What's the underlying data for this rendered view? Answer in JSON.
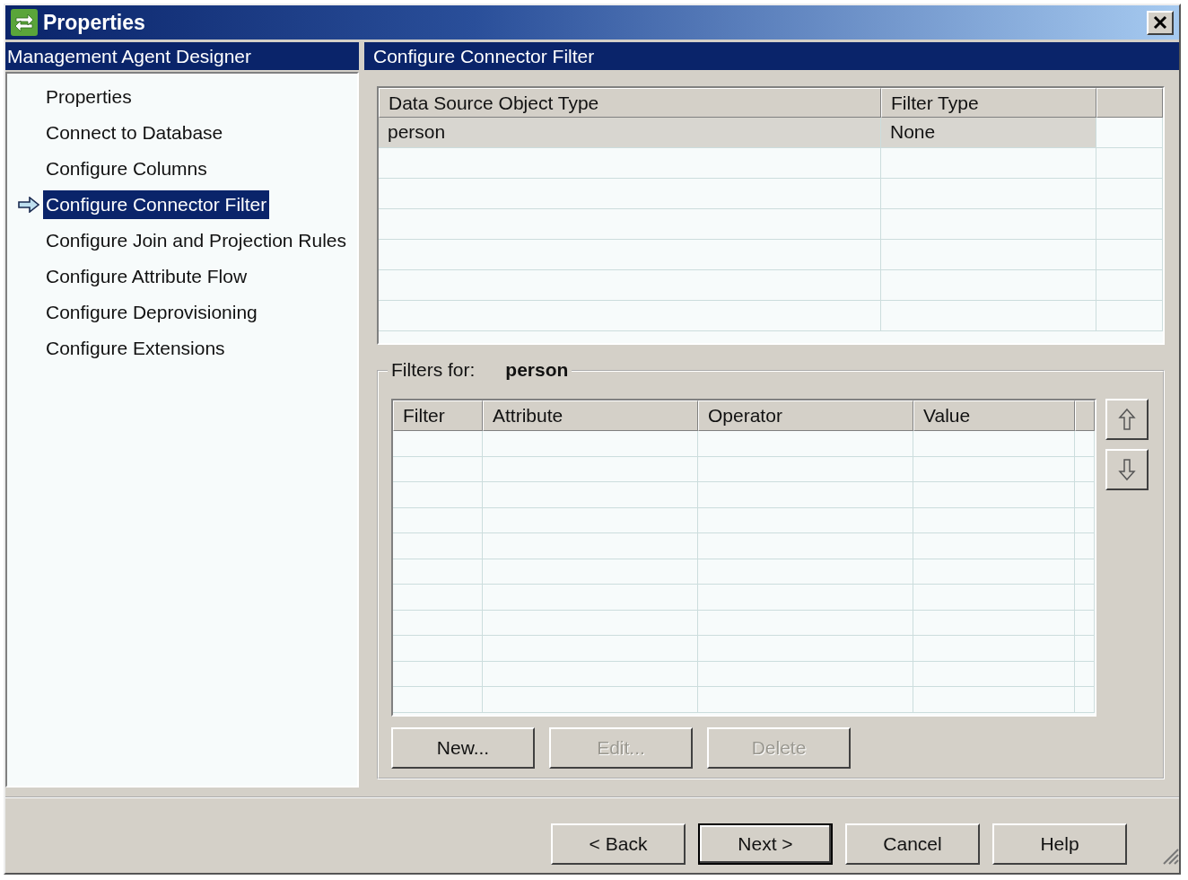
{
  "window": {
    "title": "Properties"
  },
  "nav": {
    "header": "Management Agent Designer",
    "items": [
      {
        "label": "Properties",
        "selected": false
      },
      {
        "label": "Connect to Database",
        "selected": false
      },
      {
        "label": "Configure Columns",
        "selected": false
      },
      {
        "label": "Configure Connector Filter",
        "selected": true
      },
      {
        "label": "Configure Join and Projection Rules",
        "selected": false
      },
      {
        "label": "Configure Attribute Flow",
        "selected": false
      },
      {
        "label": "Configure Deprovisioning",
        "selected": false
      },
      {
        "label": "Configure Extensions",
        "selected": false
      }
    ]
  },
  "panel": {
    "header": "Configure Connector Filter",
    "objects_table": {
      "columns": [
        "Data Source Object Type",
        "Filter Type"
      ],
      "rows": [
        {
          "cells": [
            "person",
            "None"
          ],
          "selected": true
        }
      ]
    },
    "filters": {
      "label": "Filters for:",
      "object": "person",
      "table": {
        "columns": [
          "Filter",
          "Attribute",
          "Operator",
          "Value"
        ]
      },
      "buttons": [
        {
          "label": "New...",
          "disabled": false
        },
        {
          "label": "Edit...",
          "disabled": true
        },
        {
          "label": "Delete",
          "disabled": true
        }
      ]
    }
  },
  "footer": {
    "buttons": [
      {
        "label": "< Back",
        "default": false
      },
      {
        "label": "Next >",
        "default": true
      },
      {
        "label": "Cancel",
        "default": false
      },
      {
        "label": "Help",
        "default": false
      }
    ]
  }
}
